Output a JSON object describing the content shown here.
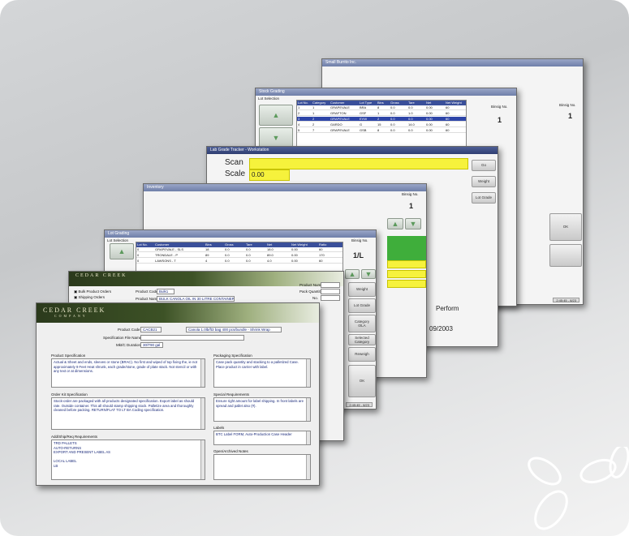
{
  "windows": {
    "w1": {
      "title": "Small Burrito Inc.",
      "box_no_label": "Binsig No.",
      "box_no_value": "1",
      "ok_label": "OK",
      "status": "2:45:45 - 8/23"
    },
    "w2": {
      "title": "Stock Grading",
      "header_label": "Lot Selection",
      "box_no_label": "Binsig No.",
      "box_no_value": "1",
      "columns": [
        "Lot No.",
        "Category",
        "Customer",
        "Lot Type",
        "Bins",
        "Gross",
        "Tare",
        "Net",
        "Net Weight"
      ],
      "rows": [
        [
          "1",
          "1",
          "GRAPEVALE",
          "BRA",
          "8",
          "0.0",
          "0.0",
          "0.00",
          "60"
        ],
        [
          "2",
          "1",
          "GRAFTON",
          "GSF",
          "1",
          "0.0",
          "1.0",
          "0.00",
          "60"
        ],
        [
          "3",
          "2",
          "GRAPEVALE",
          "EVW",
          "2",
          "0.0",
          "0.0",
          "0.00",
          "60"
        ],
        [
          "4",
          "2",
          "GARDO",
          "G",
          "15",
          "0.0",
          "14.0",
          "0.00",
          "60"
        ],
        [
          "5",
          "7",
          "GRAPEVALE",
          "GSB",
          "8",
          "0.0",
          "0.0",
          "0.00",
          "60"
        ]
      ],
      "selected_row": 2
    },
    "w3": {
      "title": "Lab Grade Tracker - Workstation",
      "scan_label": "Scan",
      "scale_label": "Scale",
      "scale_value": "0.00",
      "side_buttons": [
        "Weight",
        "Lot Grade",
        "Category",
        "Selected Category",
        "Reweigh"
      ],
      "go_label": "Go",
      "perform_label": "Perform",
      "date_text": "09/2003",
      "status": "2:45:45 - 8/23"
    },
    "w4": {
      "title": "Inventory",
      "box_no_label": "Binsig No.",
      "box_no_value": "1",
      "status": "2:45:45 - 8/23"
    },
    "w5": {
      "title": "Lot Grading",
      "header_label": "Lot Selection",
      "box_no_label": "Binsig No.",
      "box_no_value": "1/L",
      "columns": [
        "Lot No.",
        "Customer",
        "Bins",
        "Gross",
        "Tare",
        "Net",
        "Net Weight",
        "Ratio"
      ],
      "rows": [
        [
          "0",
          "GRAPEVALE - SLS",
          "18",
          "0.0",
          "0.0",
          "18.0",
          "0.00",
          "60"
        ],
        [
          "0",
          "TRONDALE - P",
          "89",
          "0.0",
          "0.0",
          "89.0",
          "0.00",
          "170"
        ],
        [
          "0",
          "LAWSONS - T",
          "4",
          "0.0",
          "0.0",
          "4.0",
          "0.00",
          "60"
        ]
      ],
      "side_buttons": [
        "Weight",
        "Lot Grade",
        "Category",
        "Selected Category",
        "Reweigh"
      ],
      "category_value": "0/LA",
      "ok_label": "OK",
      "status": "2:45:45 - 8/23"
    },
    "w6": {
      "logo": "CEDAR CREEK",
      "logo_sub": "COMPANY",
      "option_a": "Bulk Product Orders",
      "option_b": "Shipping Orders",
      "product_code_label": "Product Code",
      "product_code_value": "Bulk1",
      "product_name_label": "Product Name",
      "product_name_value": "BULK CANOLA OIL IN 30 LITRE CONTAINERS - DRAFT",
      "right_labels": [
        "Product Number",
        "Pack Quantity",
        "No."
      ]
    },
    "w7": {
      "logo": "CEDAR CREEK",
      "logo_sub": "COMPANY",
      "product_code_label": "Product Code",
      "product_code_value": "CACB21",
      "product_desc": "Canola 1.0lb/ft3 bag 400 pcs/bundle - Shrink Wrap",
      "spec_file_label": "Specification File Name",
      "mkt_label": "Mkt/C Duration",
      "mkt_value": "30/T90 gal",
      "product_spec_label": "Product Specification",
      "product_spec_text": "Actual & Sheet and ends, sleeves or stone (BRAC). No first and wiped of top fixing the, ie not approximately 9 Feet Heat shrunk, each grade/stone, grade of plate stack. Not stencil or with any text or at dimensions.",
      "packaging_spec_label": "Packaging Specification",
      "packaging_spec_text": "Case pack quantity and stacking to a palletized Case. Place product in carrier with label.",
      "order_spec_label": "Order Kit Specification",
      "order_spec_text": "Stock-order are packaged with all products designated specification. Export label as should rate. Outside container. This all should stamp shipping stock. Palletize area and thoroughly cleaned before packing. RETURN/FLAT TO LT BA Coding specification.",
      "special_req_label": "Special Requirements",
      "special_req_text": "Ensure right amount for label shipping. In front labels are spread and pallet also (#).",
      "labels_label": "Labels",
      "labels_text": "BTC Label FORM, Auto-Production Case Header",
      "addl_req_label": "Add/Ship/Req Requirements",
      "addl_req_text": "TRD PALLETS\nAUTO-RETURNS\nEXPORT AND PRESENT LABEL AS\n\nLOCAL LABEL\nLB",
      "general_notes_label": "Open/Archived Notes"
    }
  },
  "decorations": {
    "chain": "chain-link-icon",
    "arrow": "green-up-arrow-icon"
  },
  "colors": {
    "grid_header": "#3a4f9a",
    "grid_selected": "#2e45a8",
    "scan_yellow": "#f6f23c",
    "status_green": "#3fae3b",
    "banner_green": "#3d5226",
    "field_text": "#1a2a7a"
  }
}
